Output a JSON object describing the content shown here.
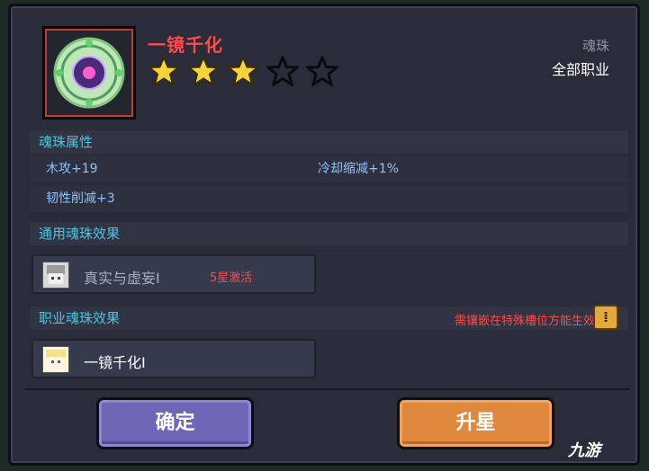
{
  "item": {
    "name": "一镜千化",
    "stars_filled": 3,
    "stars_total": 5,
    "type": "魂珠",
    "class": "全部职业"
  },
  "attributes": {
    "heading": "魂珠属性",
    "stats": [
      "木攻+19",
      "冷却缩减+1%",
      "韧性削减+3"
    ]
  },
  "general_effect": {
    "heading": "通用魂珠效果",
    "name": "真实与虚妄Ⅰ",
    "note": "5星激活"
  },
  "class_effect": {
    "heading": "职业魂珠效果",
    "warning": "需镶嵌在特殊槽位方能生效",
    "name": "一镜千化Ⅰ"
  },
  "buttons": {
    "confirm": "确定",
    "upgrade": "升星"
  },
  "watermark": "九游",
  "colors": {
    "title": "#ff4a4a",
    "section_heading": "#45c7e0",
    "stat_text": "#8fc2ff",
    "confirm_button": "#6f66b8",
    "upgrade_button": "#e0893e",
    "star_filled": "#f5d33a"
  }
}
